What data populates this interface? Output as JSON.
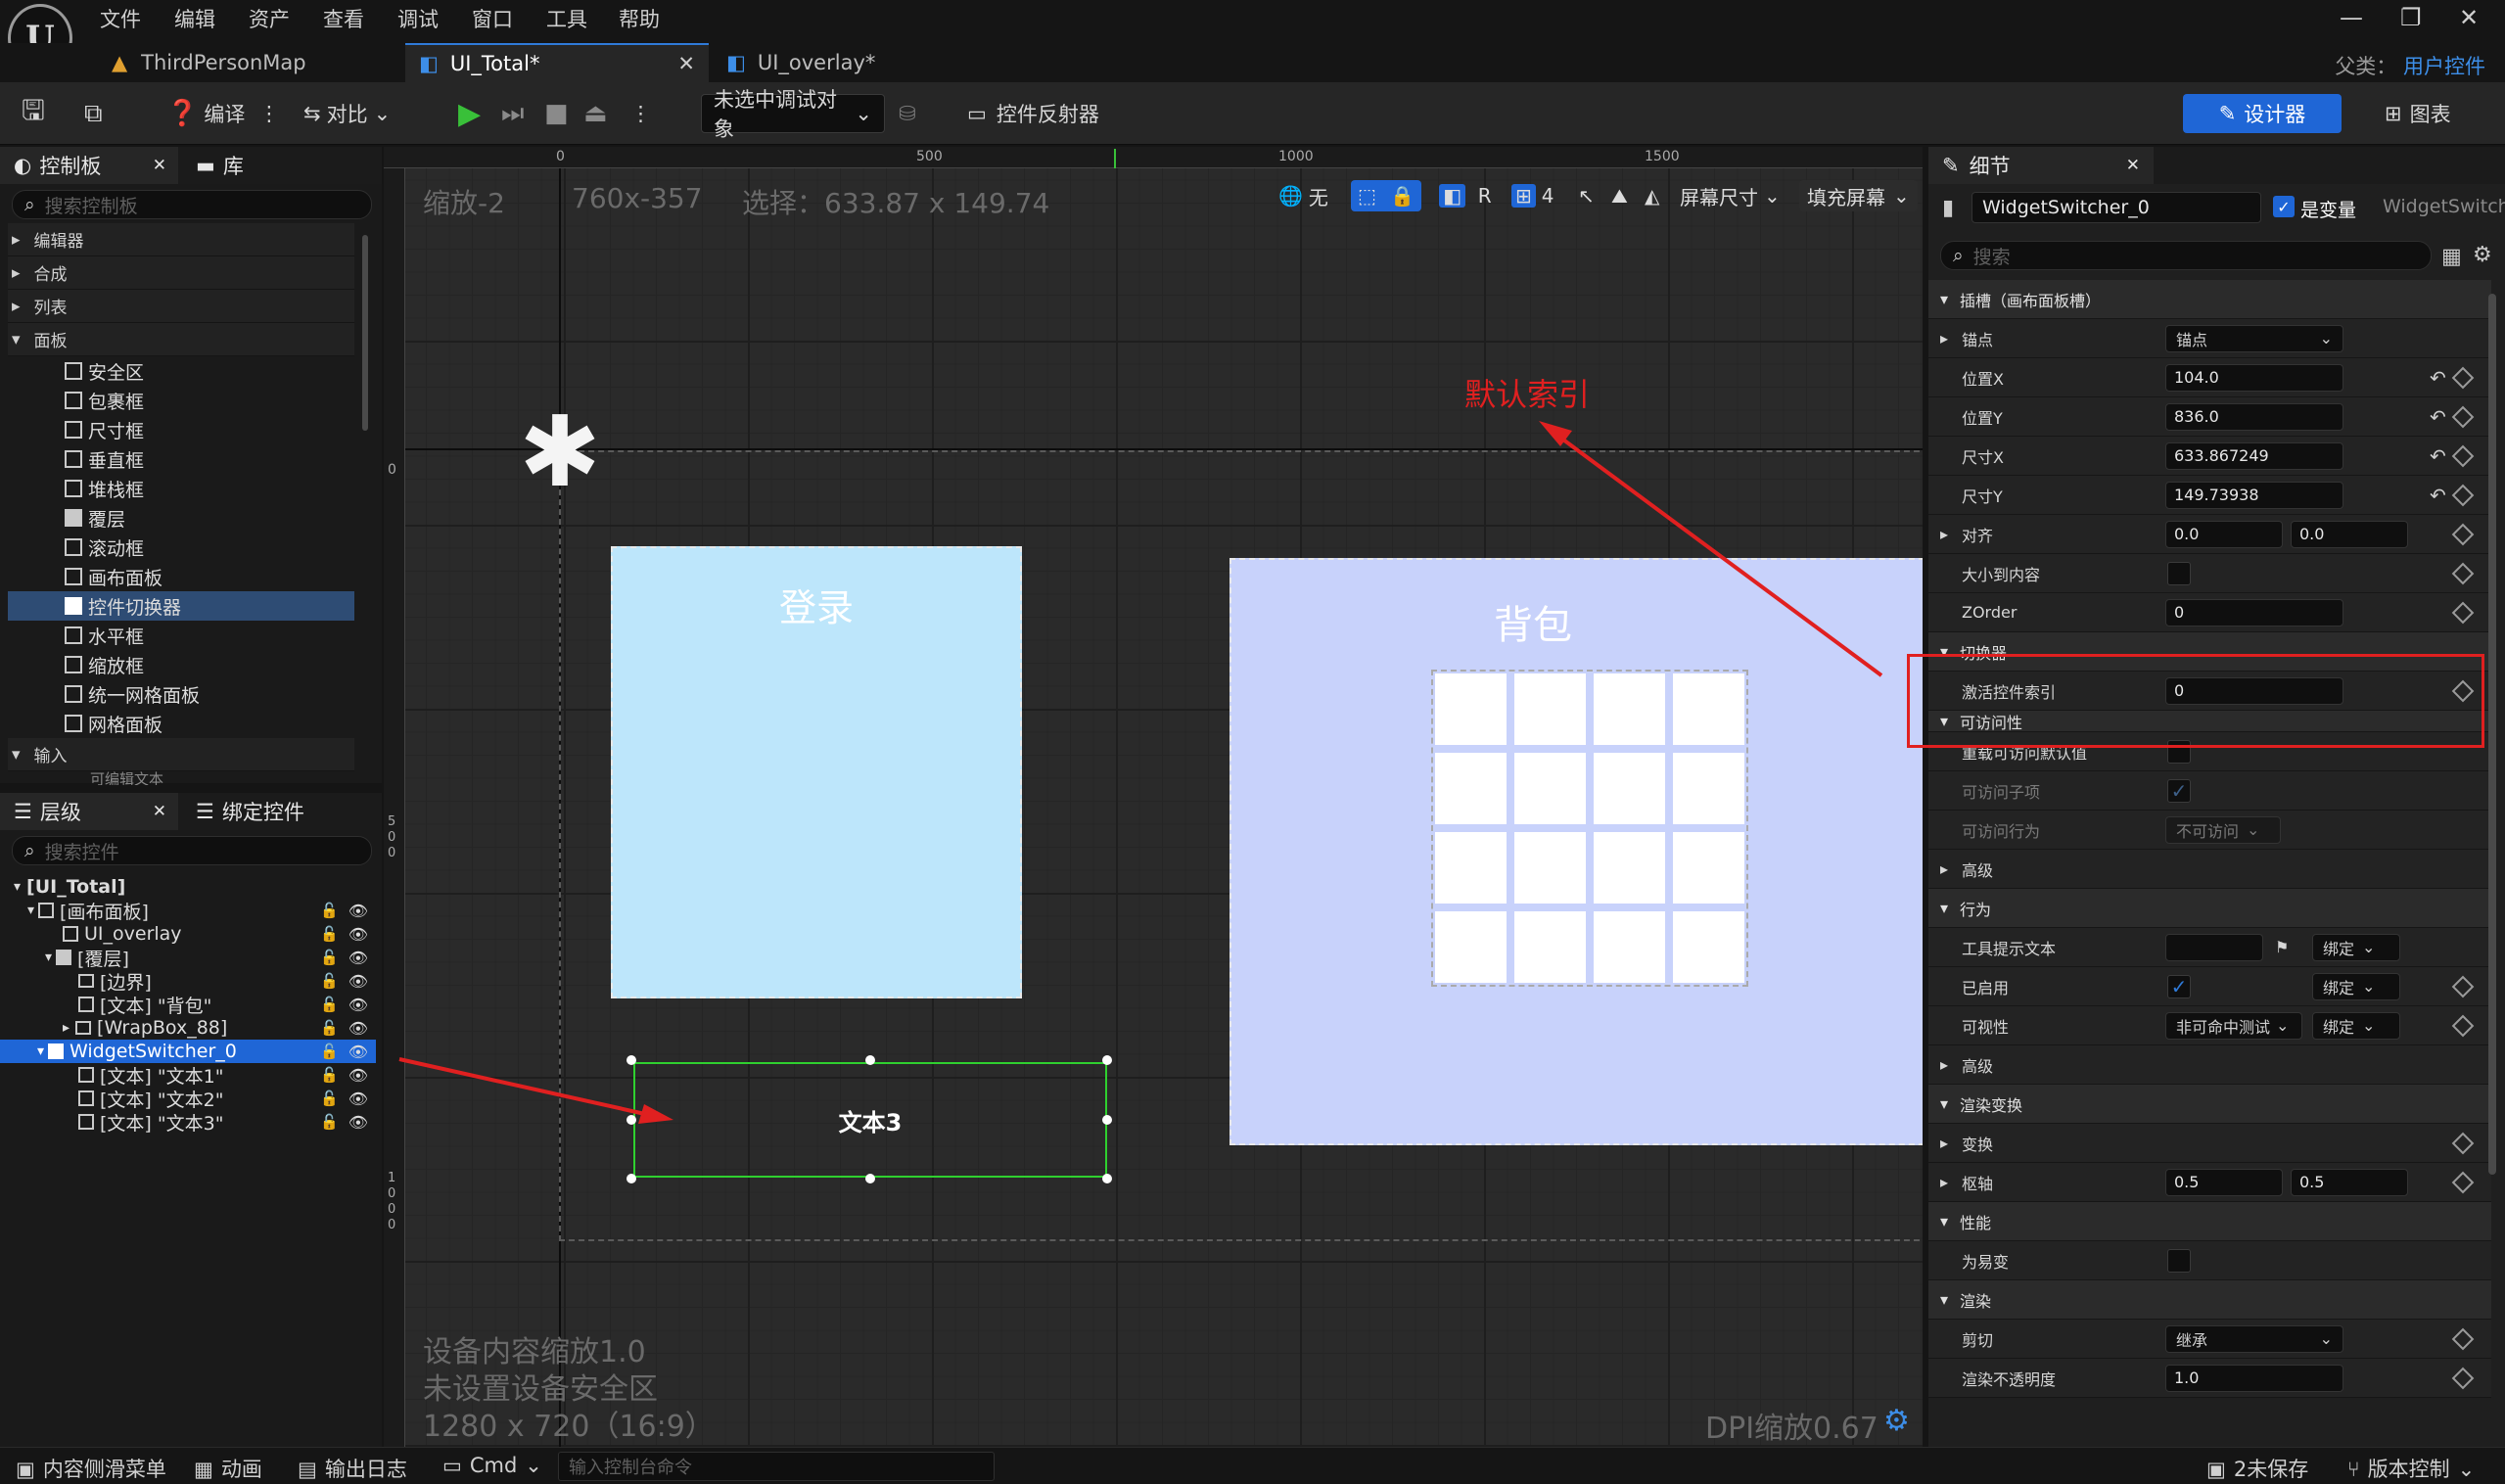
{
  "menubar": {
    "items": [
      "文件",
      "编辑",
      "资产",
      "查看",
      "调试",
      "窗口",
      "工具",
      "帮助"
    ]
  },
  "tabs": [
    {
      "label": "ThirdPersonMap"
    },
    {
      "label": "UI_Total*"
    },
    {
      "label": "UI_overlay*"
    }
  ],
  "parent_class": {
    "label": "父类：",
    "value": "用户控件"
  },
  "toolbar": {
    "compile_label": "编译",
    "diff_label": "对比",
    "debug_dropdown": "未选中调试对象",
    "widget_reflector": "控件反射器",
    "designer": "设计器",
    "graph": "图表"
  },
  "palette": {
    "tab_label": "控制板",
    "library_tab": "库",
    "search_placeholder": "搜索控制板",
    "categories": [
      "编辑器",
      "合成",
      "列表",
      "面板"
    ],
    "items": [
      "安全区",
      "包裹框",
      "尺寸框",
      "垂直框",
      "堆栈框",
      "覆层",
      "滚动框",
      "画布面板",
      "控件切换器",
      "水平框",
      "缩放框",
      "统一网格面板",
      "网格面板"
    ],
    "input_category": "输入",
    "partial_item": "可编辑文本"
  },
  "hierarchy": {
    "tab_label": "层级",
    "bind_tab": "绑定控件",
    "search_placeholder": "搜索控件",
    "rows": [
      "[UI_Total]",
      "[画布面板]",
      "UI_overlay",
      "[覆层]",
      "[边界]",
      "[文本] \"背包\"",
      "[WrapBox_88]",
      "WidgetSwitcher_0",
      "[文本] \"文本1\"",
      "[文本] \"文本2\"",
      "[文本] \"文本3\""
    ]
  },
  "viewport": {
    "zoom": "缩放-2",
    "cursor": "760x-357",
    "selection": "选择：633.87 x 149.74",
    "ruler_h": [
      "0",
      "500",
      "1000",
      "1500"
    ],
    "ruler_v_top": "0",
    "ruler_v_mid": [
      "5",
      "0",
      "0"
    ],
    "ruler_v_low": [
      "1",
      "0",
      "0",
      "0"
    ],
    "none_label": "无",
    "r_label": "R",
    "grid_num": "4",
    "screen_size": "屏幕尺寸",
    "fill_screen": "填充屏幕",
    "login_text": "登录",
    "backpack_text": "背包",
    "text3": "文本3",
    "default_index_note": "默认索引",
    "device_scale": "设备内容缩放1.0",
    "safe_zone": "未设置设备安全区",
    "resolution": "1280 x 720（16:9）",
    "dpi": "DPI缩放0.67"
  },
  "details": {
    "tab_label": "细节",
    "widget_name": "WidgetSwitcher_0",
    "is_variable": "是变量",
    "class_name": "WidgetSwitcher",
    "search_placeholder": "搜索",
    "slot_section": "插槽（画布面板槽）",
    "anchors_label": "锚点",
    "anchors_value": "锚点",
    "pos_x_label": "位置X",
    "pos_x": "104.0",
    "pos_y_label": "位置Y",
    "pos_y": "836.0",
    "size_x_label": "尺寸X",
    "size_x": "633.867249",
    "size_y_label": "尺寸Y",
    "size_y": "149.73938",
    "align_label": "对齐",
    "align_x": "0.0",
    "align_y": "0.0",
    "size_to_content": "大小到内容",
    "zorder_label": "ZOrder",
    "zorder": "0",
    "switcher_section": "切换器",
    "active_index_label": "激活控件索引",
    "active_index": "0",
    "accessibility_section": "可访问性",
    "override_access": "重载可访问默认值",
    "access_children": "可访问子项",
    "access_behavior": "可访问行为",
    "not_accessible": "不可访问",
    "advanced": "高级",
    "behavior_section": "行为",
    "tooltip_label": "工具提示文本",
    "bind": "绑定",
    "enabled_label": "已启用",
    "visibility_label": "可视性",
    "visibility_value": "非可命中测试",
    "render_transform": "渲染变换",
    "transform": "变换",
    "pivot": "枢轴",
    "pivot_x": "0.5",
    "pivot_y": "0.5",
    "performance": "性能",
    "volatile": "为易变",
    "rendering": "渲染",
    "clipping": "剪切",
    "clipping_value": "继承",
    "opacity_label": "渲染不透明度",
    "opacity": "1.0"
  },
  "statusbar": {
    "content_drawer": "内容侧滑菜单",
    "animation": "动画",
    "output_log": "输出日志",
    "cmd": "Cmd",
    "console_placeholder": "输入控制台命令",
    "unsaved": "2未保存",
    "source_control": "版本控制"
  },
  "colors": {
    "accent": "#1f66d6",
    "annotation": "#e02020",
    "login_bg": "#bde6fb",
    "backpack_bg": "#c8d2fb"
  }
}
